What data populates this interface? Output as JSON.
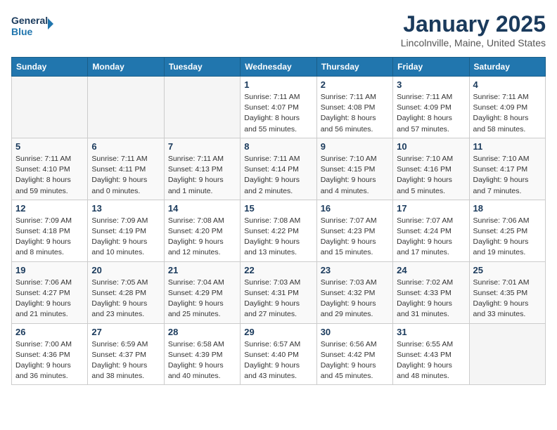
{
  "header": {
    "logo_line1": "General",
    "logo_line2": "Blue",
    "month": "January 2025",
    "location": "Lincolnville, Maine, United States"
  },
  "weekdays": [
    "Sunday",
    "Monday",
    "Tuesday",
    "Wednesday",
    "Thursday",
    "Friday",
    "Saturday"
  ],
  "weeks": [
    [
      {
        "day": "",
        "info": ""
      },
      {
        "day": "",
        "info": ""
      },
      {
        "day": "",
        "info": ""
      },
      {
        "day": "1",
        "info": "Sunrise: 7:11 AM\nSunset: 4:07 PM\nDaylight: 8 hours\nand 55 minutes."
      },
      {
        "day": "2",
        "info": "Sunrise: 7:11 AM\nSunset: 4:08 PM\nDaylight: 8 hours\nand 56 minutes."
      },
      {
        "day": "3",
        "info": "Sunrise: 7:11 AM\nSunset: 4:09 PM\nDaylight: 8 hours\nand 57 minutes."
      },
      {
        "day": "4",
        "info": "Sunrise: 7:11 AM\nSunset: 4:09 PM\nDaylight: 8 hours\nand 58 minutes."
      }
    ],
    [
      {
        "day": "5",
        "info": "Sunrise: 7:11 AM\nSunset: 4:10 PM\nDaylight: 8 hours\nand 59 minutes."
      },
      {
        "day": "6",
        "info": "Sunrise: 7:11 AM\nSunset: 4:11 PM\nDaylight: 9 hours\nand 0 minutes."
      },
      {
        "day": "7",
        "info": "Sunrise: 7:11 AM\nSunset: 4:13 PM\nDaylight: 9 hours\nand 1 minute."
      },
      {
        "day": "8",
        "info": "Sunrise: 7:11 AM\nSunset: 4:14 PM\nDaylight: 9 hours\nand 2 minutes."
      },
      {
        "day": "9",
        "info": "Sunrise: 7:10 AM\nSunset: 4:15 PM\nDaylight: 9 hours\nand 4 minutes."
      },
      {
        "day": "10",
        "info": "Sunrise: 7:10 AM\nSunset: 4:16 PM\nDaylight: 9 hours\nand 5 minutes."
      },
      {
        "day": "11",
        "info": "Sunrise: 7:10 AM\nSunset: 4:17 PM\nDaylight: 9 hours\nand 7 minutes."
      }
    ],
    [
      {
        "day": "12",
        "info": "Sunrise: 7:09 AM\nSunset: 4:18 PM\nDaylight: 9 hours\nand 8 minutes."
      },
      {
        "day": "13",
        "info": "Sunrise: 7:09 AM\nSunset: 4:19 PM\nDaylight: 9 hours\nand 10 minutes."
      },
      {
        "day": "14",
        "info": "Sunrise: 7:08 AM\nSunset: 4:20 PM\nDaylight: 9 hours\nand 12 minutes."
      },
      {
        "day": "15",
        "info": "Sunrise: 7:08 AM\nSunset: 4:22 PM\nDaylight: 9 hours\nand 13 minutes."
      },
      {
        "day": "16",
        "info": "Sunrise: 7:07 AM\nSunset: 4:23 PM\nDaylight: 9 hours\nand 15 minutes."
      },
      {
        "day": "17",
        "info": "Sunrise: 7:07 AM\nSunset: 4:24 PM\nDaylight: 9 hours\nand 17 minutes."
      },
      {
        "day": "18",
        "info": "Sunrise: 7:06 AM\nSunset: 4:25 PM\nDaylight: 9 hours\nand 19 minutes."
      }
    ],
    [
      {
        "day": "19",
        "info": "Sunrise: 7:06 AM\nSunset: 4:27 PM\nDaylight: 9 hours\nand 21 minutes."
      },
      {
        "day": "20",
        "info": "Sunrise: 7:05 AM\nSunset: 4:28 PM\nDaylight: 9 hours\nand 23 minutes."
      },
      {
        "day": "21",
        "info": "Sunrise: 7:04 AM\nSunset: 4:29 PM\nDaylight: 9 hours\nand 25 minutes."
      },
      {
        "day": "22",
        "info": "Sunrise: 7:03 AM\nSunset: 4:31 PM\nDaylight: 9 hours\nand 27 minutes."
      },
      {
        "day": "23",
        "info": "Sunrise: 7:03 AM\nSunset: 4:32 PM\nDaylight: 9 hours\nand 29 minutes."
      },
      {
        "day": "24",
        "info": "Sunrise: 7:02 AM\nSunset: 4:33 PM\nDaylight: 9 hours\nand 31 minutes."
      },
      {
        "day": "25",
        "info": "Sunrise: 7:01 AM\nSunset: 4:35 PM\nDaylight: 9 hours\nand 33 minutes."
      }
    ],
    [
      {
        "day": "26",
        "info": "Sunrise: 7:00 AM\nSunset: 4:36 PM\nDaylight: 9 hours\nand 36 minutes."
      },
      {
        "day": "27",
        "info": "Sunrise: 6:59 AM\nSunset: 4:37 PM\nDaylight: 9 hours\nand 38 minutes."
      },
      {
        "day": "28",
        "info": "Sunrise: 6:58 AM\nSunset: 4:39 PM\nDaylight: 9 hours\nand 40 minutes."
      },
      {
        "day": "29",
        "info": "Sunrise: 6:57 AM\nSunset: 4:40 PM\nDaylight: 9 hours\nand 43 minutes."
      },
      {
        "day": "30",
        "info": "Sunrise: 6:56 AM\nSunset: 4:42 PM\nDaylight: 9 hours\nand 45 minutes."
      },
      {
        "day": "31",
        "info": "Sunrise: 6:55 AM\nSunset: 4:43 PM\nDaylight: 9 hours\nand 48 minutes."
      },
      {
        "day": "",
        "info": ""
      }
    ]
  ]
}
